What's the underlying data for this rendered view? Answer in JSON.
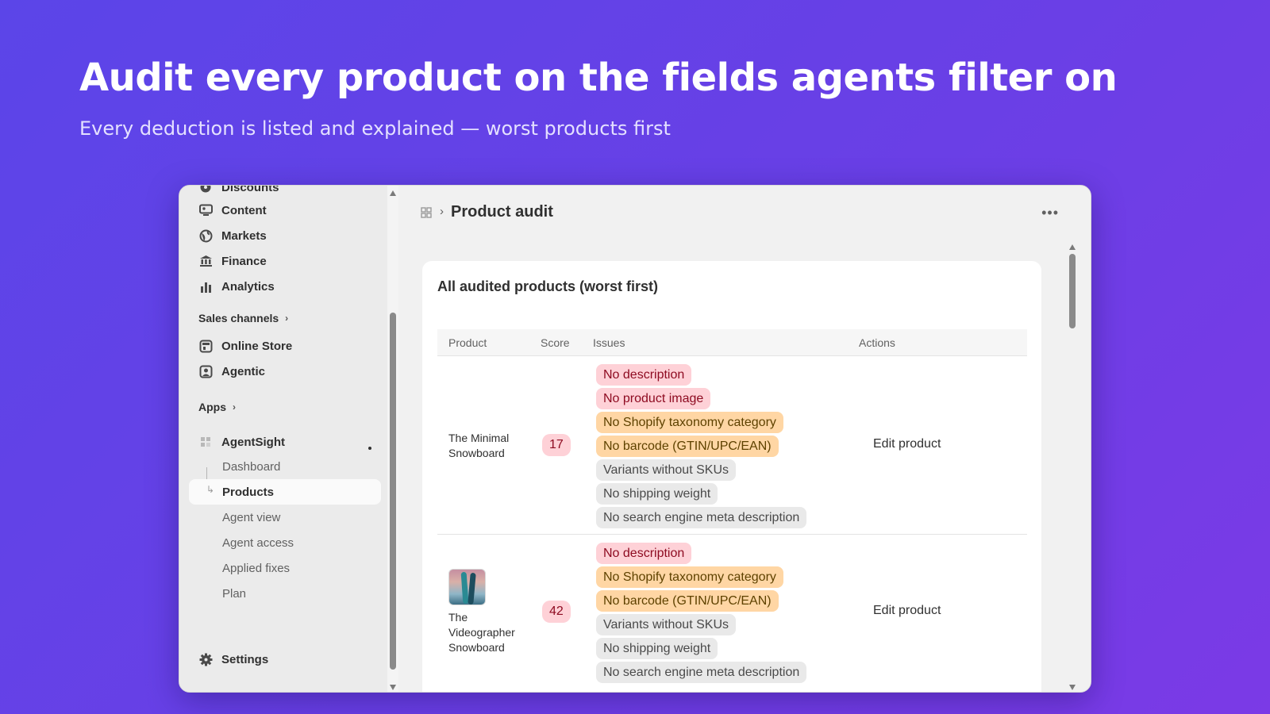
{
  "hero": {
    "title": "Audit every product on the fields agents filter on",
    "subtitle": "Every deduction is listed and explained — worst products first"
  },
  "sidebar": {
    "top_items": [
      {
        "label": "Discounts",
        "icon": "discount-icon"
      },
      {
        "label": "Content",
        "icon": "content-icon"
      },
      {
        "label": "Markets",
        "icon": "globe-icon"
      },
      {
        "label": "Finance",
        "icon": "bank-icon"
      },
      {
        "label": "Analytics",
        "icon": "bar-chart-icon"
      }
    ],
    "sales_channels_label": "Sales channels",
    "channels": [
      {
        "label": "Online Store",
        "icon": "store-icon"
      },
      {
        "label": "Agentic",
        "icon": "agentic-icon"
      }
    ],
    "apps_label": "Apps",
    "app": {
      "label": "AgentSight",
      "sub_items": [
        "Dashboard",
        "Products",
        "Agent view",
        "Agent access",
        "Applied fixes",
        "Plan"
      ],
      "active": "Products"
    },
    "settings_label": "Settings"
  },
  "header": {
    "page_title": "Product audit"
  },
  "card": {
    "title": "All audited products (worst first)",
    "columns": [
      "Product",
      "Score",
      "Issues",
      "Actions"
    ]
  },
  "rows": [
    {
      "product": "The Minimal Snowboard",
      "score": "17",
      "has_image": false,
      "issues": [
        {
          "label": "No description",
          "severity": "critical"
        },
        {
          "label": "No product image",
          "severity": "critical"
        },
        {
          "label": "No Shopify taxonomy category",
          "severity": "warning"
        },
        {
          "label": "No barcode (GTIN/UPC/EAN)",
          "severity": "warning"
        },
        {
          "label": "Variants without SKUs",
          "severity": "info"
        },
        {
          "label": "No shipping weight",
          "severity": "info"
        },
        {
          "label": "No search engine meta description",
          "severity": "info"
        }
      ],
      "action": "Edit product"
    },
    {
      "product": "The Videographer Snowboard",
      "score": "42",
      "has_image": true,
      "issues": [
        {
          "label": "No description",
          "severity": "critical"
        },
        {
          "label": "No Shopify taxonomy category",
          "severity": "warning"
        },
        {
          "label": "No barcode (GTIN/UPC/EAN)",
          "severity": "warning"
        },
        {
          "label": "Variants without SKUs",
          "severity": "info"
        },
        {
          "label": "No shipping weight",
          "severity": "info"
        },
        {
          "label": "No search engine meta description",
          "severity": "info"
        }
      ],
      "action": "Edit product"
    }
  ],
  "colors": {
    "background_start": "#5b45e8",
    "background_end": "#7b3ae6",
    "critical_bg": "#fed1d7",
    "warning_bg": "#ffd6a4",
    "info_bg": "#e9e9e9"
  }
}
